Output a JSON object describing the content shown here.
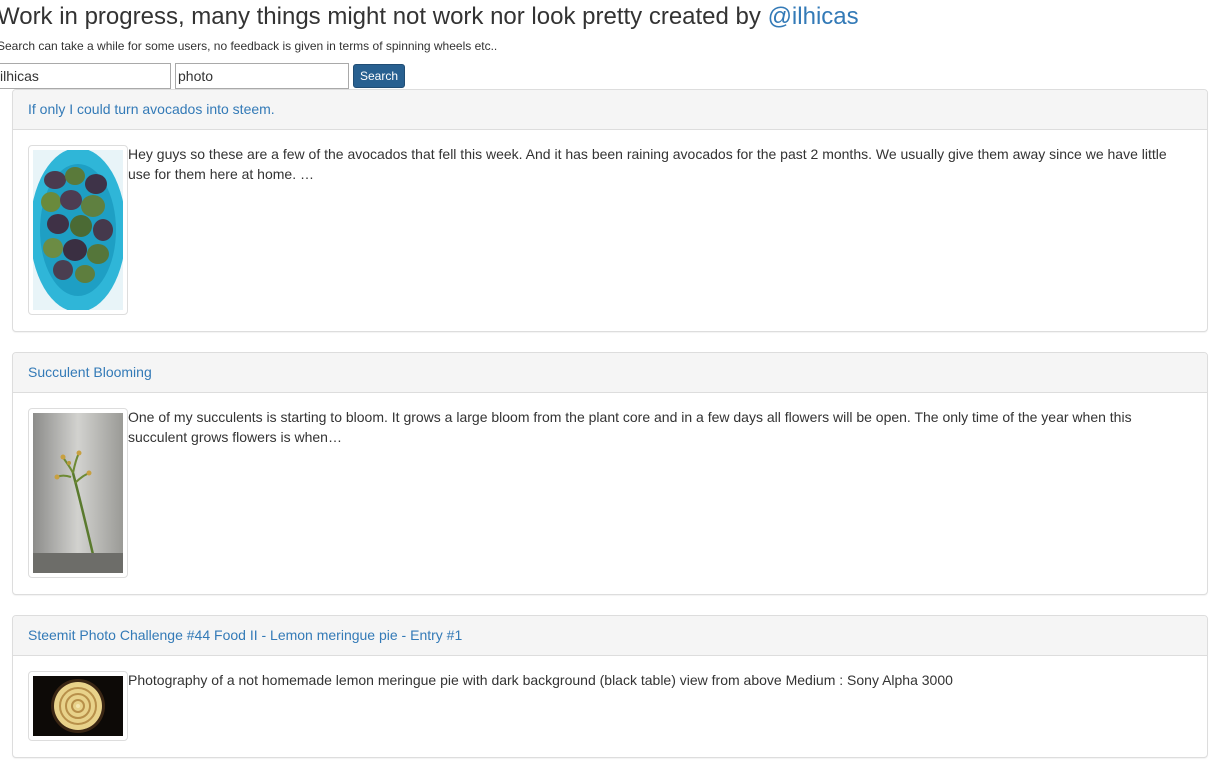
{
  "header": {
    "title_prefix": "Work in progress, many things might not work nor look pretty created by ",
    "author_link": "@ilhicas",
    "note": "Search can take a while for some users, no feedback is given in terms of spinning wheels etc.."
  },
  "search": {
    "user_value": "ilhicas",
    "term_value": "photo",
    "button_label": "Search"
  },
  "results": [
    {
      "title": "If only I could turn avocados into steem.",
      "excerpt": "Hey guys so these are a few of the avocados that fell this week. And it has been raining avocados for the past 2 months. We usually give them away since we have little use for them here at home. …",
      "thumbnail": "avocados-photo"
    },
    {
      "title": "Succulent Blooming",
      "excerpt": "One of my succulents is starting to bloom. It grows a large bloom from the plant core and in a few days all flowers will be open. The only time of the year when this succulent grows flowers is when…",
      "thumbnail": "succulent-photo"
    },
    {
      "title": "Steemit Photo Challenge #44 Food II - Lemon meringue pie - Entry #1",
      "excerpt": "Photography of a not homemade lemon meringue pie with dark background (black table) view from above Medium : Sony Alpha 3000",
      "thumbnail": "meringue-pie-photo"
    }
  ],
  "colors": {
    "link": "#337ab7",
    "button": "#286090",
    "panel_heading_bg": "#f5f5f5",
    "panel_border": "#dddddd"
  }
}
